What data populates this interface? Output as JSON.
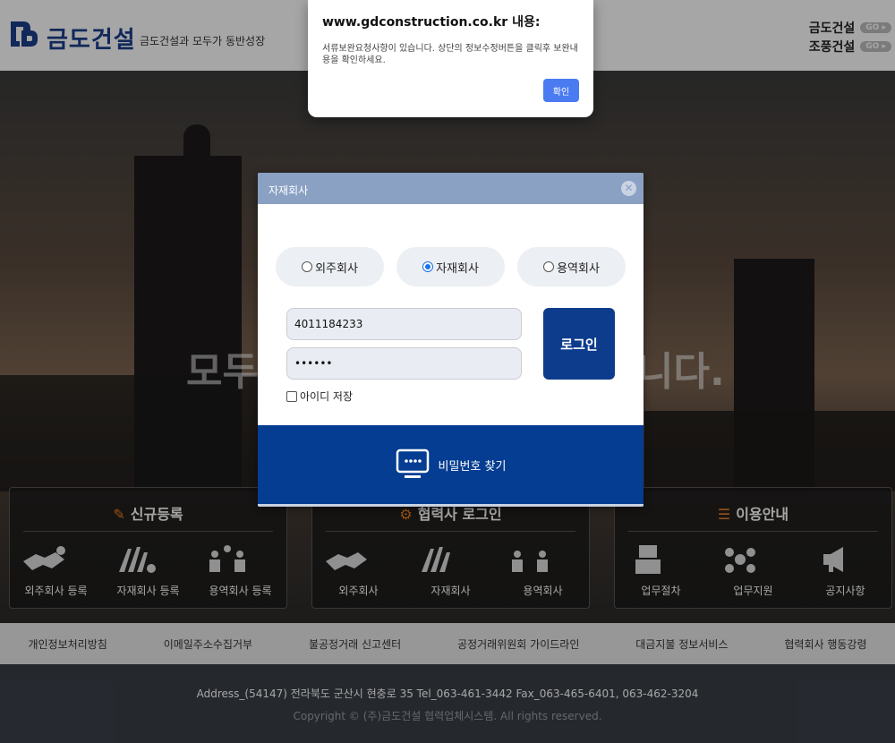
{
  "header": {
    "brand": "금도건설",
    "tagline": "금도건설과 모두가 동반성장",
    "links": [
      {
        "name": "금도건설",
        "badge": "GO"
      },
      {
        "name": "조풍건설",
        "badge": "GO"
      }
    ]
  },
  "hero": {
    "text_left": "모두",
    "text_right": "니다."
  },
  "cards": [
    {
      "title": "신규등록",
      "title_icon": "edit-icon",
      "items": [
        {
          "label": "외주회사 등록",
          "icon": "handshake-icon"
        },
        {
          "label": "자재회사 등록",
          "icon": "materials-icon"
        },
        {
          "label": "용역회사 등록",
          "icon": "workers-icon"
        }
      ]
    },
    {
      "title": "협력사 로그인",
      "title_icon": "gear-icon",
      "items": [
        {
          "label": "외주회사",
          "icon": "handshake-icon"
        },
        {
          "label": "자재회사",
          "icon": "materials-icon"
        },
        {
          "label": "용역회사",
          "icon": "workers-icon"
        }
      ]
    },
    {
      "title": "이용안내",
      "title_icon": "list-icon",
      "items": [
        {
          "label": "업무절차",
          "icon": "document-icon"
        },
        {
          "label": "업무지원",
          "icon": "network-icon"
        },
        {
          "label": "공지사항",
          "icon": "megaphone-icon"
        }
      ]
    }
  ],
  "footer_nav": [
    "개인정보처리방침",
    "이메일주소수집거부",
    "불공정거래 신고센터",
    "공정거래위원회 가이드라인",
    "대금지불 정보서비스",
    "협력회사 행동강령"
  ],
  "footer": {
    "address": "Address_(54147) 전라북도 군산시 현충로 35   Tel_063-461-3442   Fax_063-465-6401, 063-462-3204",
    "copyright": "Copyright © (주)금도건설 협력업체시스템. All rights reserved."
  },
  "modal": {
    "title": "자재회사",
    "company_types": [
      {
        "label": "외주회사",
        "selected": false
      },
      {
        "label": "자재회사",
        "selected": true
      },
      {
        "label": "용역회사",
        "selected": false
      }
    ],
    "id_value": "4011184233",
    "password_value": "••••••",
    "login_label": "로그인",
    "remember_label": "아이디 저장",
    "find_password_label": "비밀번호 찾기"
  },
  "alert": {
    "title": "www.gdconstruction.co.kr 내용:",
    "message": "서류보완요청사항이 있습니다. 상단의 정보수정버튼을 클릭후 보완내용을 확인하세요.",
    "ok_label": "확인"
  },
  "colors": {
    "brand_navy": "#0d3c8c",
    "modal_header": "#8aa1c4",
    "accent_orange": "#e67e22",
    "alert_button": "#4a7bf0"
  }
}
